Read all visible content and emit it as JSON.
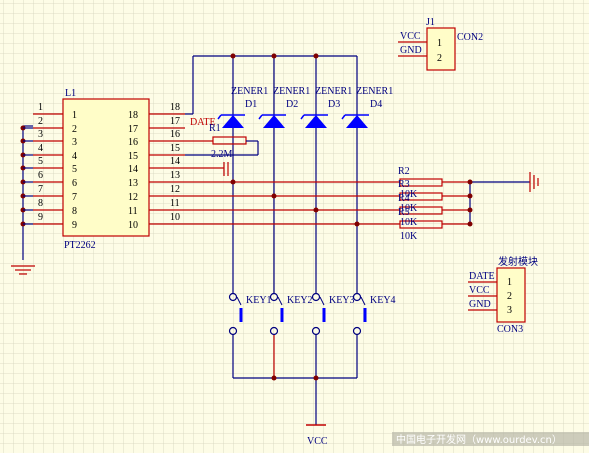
{
  "chip": {
    "designator": "L1",
    "part": "PT2262",
    "left_pins": [
      "1",
      "2",
      "3",
      "4",
      "5",
      "6",
      "7",
      "8",
      "9"
    ],
    "right_pins": [
      "18",
      "17",
      "16",
      "15",
      "14",
      "13",
      "12",
      "11",
      "10"
    ],
    "outer_left_pins": [
      "1",
      "2",
      "3",
      "4",
      "5",
      "6",
      "7",
      "8",
      "9"
    ],
    "outer_right_pins": [
      "18",
      "17",
      "16",
      "15",
      "14",
      "13",
      "12",
      "11",
      "10"
    ]
  },
  "diodes": {
    "type_label": "ZENER1",
    "designators": [
      "D1",
      "D2",
      "D3",
      "D4"
    ]
  },
  "resistor_osc": {
    "designator": "R1",
    "value": "2.2M"
  },
  "data_net": "DATE",
  "resistors": {
    "designators": [
      "R2",
      "R3",
      "R4",
      "R5"
    ],
    "value": "10K"
  },
  "keys": [
    "KEY1",
    "KEY2",
    "KEY3",
    "KEY4"
  ],
  "power_label": "VCC",
  "j1": {
    "designator": "J1",
    "part": "CON2",
    "net_labels": [
      "VCC",
      "GND"
    ],
    "pins": [
      "1",
      "2"
    ]
  },
  "j2": {
    "title": "发射模块",
    "part": "CON3",
    "net_labels": [
      "DATE",
      "VCC",
      "GND"
    ],
    "pins": [
      "1",
      "2",
      "3"
    ]
  },
  "watermark": "中国电子开发网（www.ourdev.cn）",
  "colors": {
    "background": "#fdfce6",
    "grid": "#d4d4bc",
    "wire": "#000080",
    "component": "#c00000",
    "diode": "#0000ff",
    "junction": "#800000",
    "chip_fill": "#fffdc8",
    "label": "#000080",
    "pin_text": "#000000"
  }
}
